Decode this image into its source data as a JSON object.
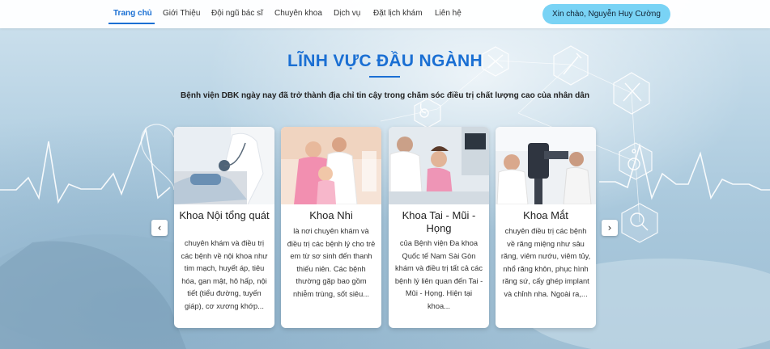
{
  "nav": {
    "items": [
      {
        "label": "Trang chủ",
        "active": true
      },
      {
        "label": "Giới Thiệu",
        "active": false
      },
      {
        "label": "Đội ngũ bác sĩ",
        "active": false
      },
      {
        "label": "Chuyên khoa",
        "active": false
      },
      {
        "label": "Dịch vụ",
        "active": false
      },
      {
        "label": "Đặt lịch khám",
        "active": false
      },
      {
        "label": "Liên hệ",
        "active": false
      }
    ],
    "greeting": "Xin chào, Nguyễn Huy Cường"
  },
  "section": {
    "title": "LĨNH VỰC ĐẦU NGÀNH",
    "subtitle": "Bệnh viện DBK ngày nay đã trở thành địa chỉ tin cậy trong chăm sóc điều trị chất lượng cao của nhân dân"
  },
  "carousel": {
    "prev_icon": "chevron-left-icon",
    "prev_glyph": "‹",
    "next_icon": "chevron-right-icon",
    "next_glyph": "›"
  },
  "cards": [
    {
      "title": "Khoa Nội tổng quát",
      "desc": "chuyên khám và điều trị các bệnh về nội khoa như tim mạch, huyết áp, tiêu hóa, gan mật, hô hấp, nội tiết (tiểu đường, tuyến giáp), cơ xương khớp..."
    },
    {
      "title": "Khoa Nhi",
      "desc": "là nơi chuyên khám và điều trị các bệnh lý cho trẻ em từ sơ sinh đến thanh thiếu niên. Các bệnh thường gặp bao gồm nhiễm trùng, sốt siêu..."
    },
    {
      "title": "Khoa Tai - Mũi - Họng",
      "desc": "của Bệnh viện Đa khoa Quốc tế Nam Sài Gòn khám và điều trị tất cả các bệnh lý liên quan đến Tai - Mũi - Họng. Hiện tại khoa..."
    },
    {
      "title": "Khoa Mắt",
      "desc": "chuyên điều trị các bệnh về răng miệng như sâu răng, viêm nướu, viêm tủy, nhổ răng khôn, phục hình răng sứ, cấy ghép implant và chỉnh nha. Ngoài ra,..."
    }
  ],
  "colors": {
    "accent": "#1a6fd3",
    "greeting_bg": "#79d3f5"
  }
}
